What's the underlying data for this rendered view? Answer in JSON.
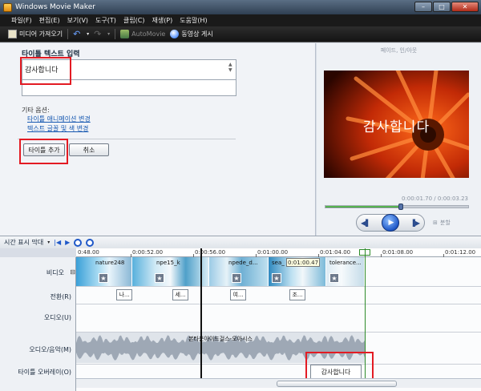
{
  "window": {
    "title": "Windows Movie Maker",
    "min": "–",
    "max": "□",
    "close": "✕"
  },
  "menu": [
    "파일(F)",
    "편집(E)",
    "보기(V)",
    "도구(T)",
    "클립(C)",
    "재생(P)",
    "도움말(H)"
  ],
  "toolbar": {
    "import_label": "미디어 가져오기",
    "automovie_label": "AutoMovie",
    "publish_label": "동영상 게시",
    "icons": {
      "import": "film-import-icon",
      "undo": "undo-icon",
      "redo": "redo-icon",
      "publish": "globe-icon"
    }
  },
  "title_panel": {
    "heading": "타이틀 텍스트 입력",
    "text_value": "감사합니다",
    "other_options": "기타 옵션:",
    "link_animation": "타이틀 애니메이션 변경",
    "link_font": "텍스트 글꼴 및 색 변경",
    "add_button": "타이틀 추가",
    "cancel_button": "취소"
  },
  "preview": {
    "effect_label": "페이드, 인/아웃",
    "screen_text": "감사합니다",
    "timecode": "0:00:01.70 / 0:00:03.23",
    "progress": 0.53,
    "split_label": "분할"
  },
  "timeline": {
    "label": "시간 표시 막대",
    "ruler": [
      "0:48.00",
      "0:00:52.00",
      "0:00:56.00",
      "0:01:00.00",
      "0:01:04.00",
      "0:01:08.00",
      "0:01:12.00"
    ],
    "tracks": {
      "video": "비디오",
      "expand": "⊟",
      "transition": "전환(R)",
      "audio": "오디오(U)",
      "music": "오디오/음악(M)",
      "overlay": "타이틀 오버레이(O)"
    },
    "clips": [
      "nature248",
      "npe15_k",
      "npede_d...",
      "sea_",
      "tolerance..."
    ],
    "transitions": [
      "나...",
      "세...",
      "여...",
      "조..."
    ],
    "tooltip": "0:01:00.47",
    "music_clip": "본타운아이드걸스-오아시스",
    "overlay_clip": "감사합니다"
  },
  "colors": {
    "accent": "#1f58c8",
    "highlight": "#e31b23"
  }
}
